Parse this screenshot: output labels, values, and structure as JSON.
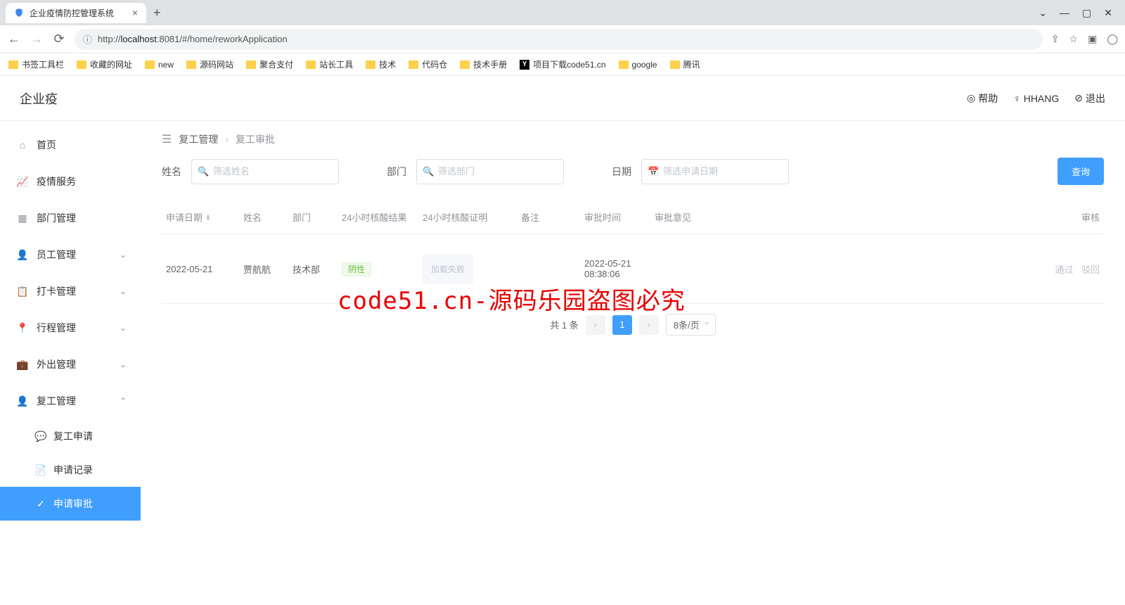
{
  "browser": {
    "tab_title": "企业疫情防控管理系统",
    "url_prefix": "http://",
    "url_host": "localhost",
    "url_rest": ":8081/#/home/reworkApplication",
    "bookmarks": [
      "书签工具栏",
      "收藏的网址",
      "new",
      "源码网站",
      "聚合支付",
      "站长工具",
      "技术",
      "代码仓",
      "技术手册",
      "项目下载code51.cn",
      "google",
      "腾讯"
    ]
  },
  "header": {
    "logo": "企业疫",
    "help": "帮助",
    "user": "HHANG",
    "logout": "退出"
  },
  "sidebar": {
    "items": [
      {
        "label": "首页",
        "icon": "home"
      },
      {
        "label": "疫情服务",
        "icon": "chart"
      },
      {
        "label": "部门管理",
        "icon": "grid"
      },
      {
        "label": "员工管理",
        "icon": "user",
        "expandable": true,
        "chev": "⌄"
      },
      {
        "label": "打卡管理",
        "icon": "clipboard",
        "expandable": true,
        "chev": "⌄"
      },
      {
        "label": "行程管理",
        "icon": "pin",
        "expandable": true,
        "chev": "⌄"
      },
      {
        "label": "外出管理",
        "icon": "briefcase",
        "expandable": true,
        "chev": "⌄"
      },
      {
        "label": "复工管理",
        "icon": "user2",
        "expandable": true,
        "chev": "⌃"
      }
    ],
    "sub": [
      {
        "label": "复工申请",
        "icon": "chat"
      },
      {
        "label": "申请记录",
        "icon": "doc"
      },
      {
        "label": "申请审批",
        "icon": "check",
        "active": true
      }
    ]
  },
  "breadcrumb": {
    "a": "复工管理",
    "b": "复工审批"
  },
  "filters": {
    "name_label": "姓名",
    "name_placeholder": "筛选姓名",
    "dept_label": "部门",
    "dept_placeholder": "筛选部门",
    "date_label": "日期",
    "date_placeholder": "筛选申请日期",
    "search_btn": "查询"
  },
  "table": {
    "headers": {
      "date": "申请日期",
      "name": "姓名",
      "dept": "部门",
      "result": "24小时核酸结果",
      "proof": "24小时核酸证明",
      "remark": "备注",
      "time": "审批时间",
      "opinion": "审批意见",
      "action": "审核"
    },
    "row": {
      "date": "2022-05-21",
      "name": "贾航航",
      "dept": "技术部",
      "result": "阴性",
      "proof_fail": "加载失败",
      "remark": "",
      "time": "2022-05-21 08:38:06",
      "opinion": "",
      "pass": "通过",
      "reject": "驳回"
    }
  },
  "pagination": {
    "total": "共 1 条",
    "page": "1",
    "size": "8条/页"
  },
  "watermark": "code51.cn-源码乐园盗图必究"
}
